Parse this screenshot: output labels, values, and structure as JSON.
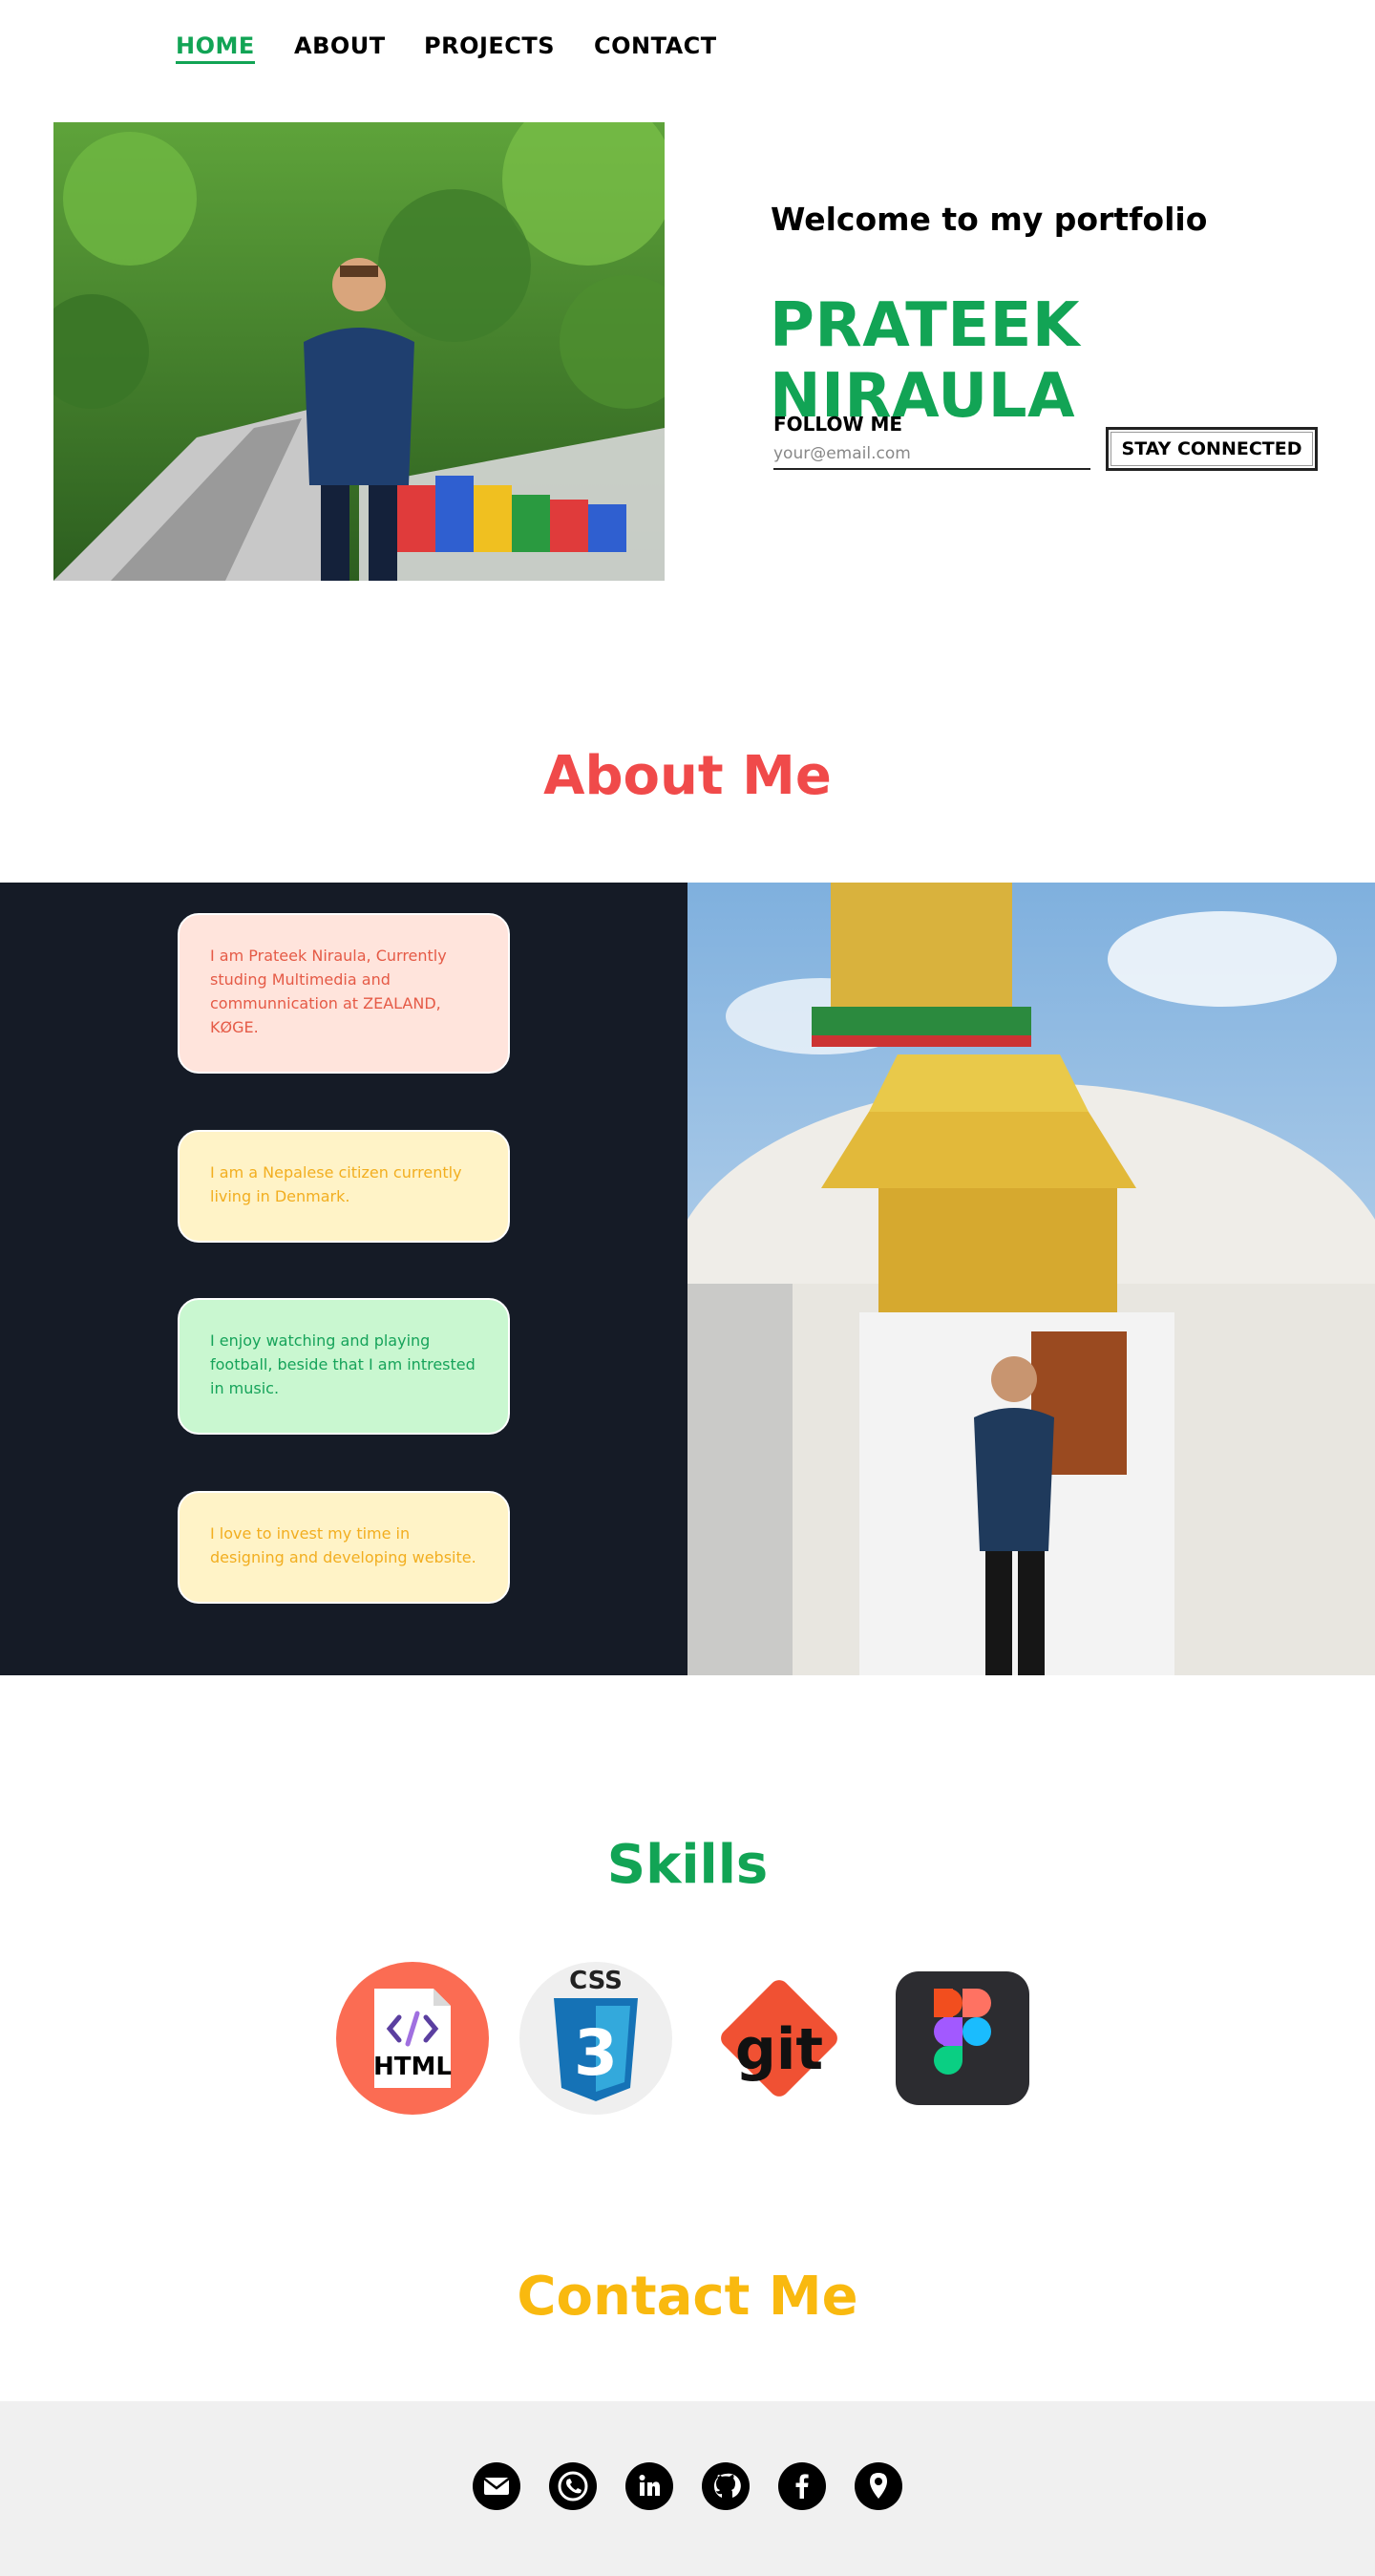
{
  "nav": {
    "items": [
      {
        "label": "HOME"
      },
      {
        "label": "ABOUT"
      },
      {
        "label": "PROJECTS"
      },
      {
        "label": "CONTACT"
      }
    ],
    "active_color": "#12a455"
  },
  "hero": {
    "welcome": "Welcome to my portfolio",
    "name": "PRATEEK NIRAULA",
    "follow_label": "FOLLOW ME",
    "email_placeholder": "your@email.com",
    "button_label": "STAY CONNECTED"
  },
  "about": {
    "heading": "About Me",
    "cards": [
      {
        "text": "I am Prateek Niraula, Currently studing Multimedia and communnication at ZEALAND, KØGE."
      },
      {
        "text": "I am a Nepalese citizen currently living in Denmark."
      },
      {
        "text": "I enjoy watching and playing football, beside that I am intrested in music."
      },
      {
        "text": "I love to invest my time in designing and developing website."
      }
    ]
  },
  "skills": {
    "heading": "Skills",
    "items": [
      {
        "name": "html-icon",
        "label": "HTML"
      },
      {
        "name": "css-icon",
        "label": "CSS"
      },
      {
        "name": "git-icon",
        "label": "git"
      },
      {
        "name": "figma-icon"
      }
    ]
  },
  "contact": {
    "heading": "Contact Me",
    "socials": [
      "email-icon",
      "phone-icon",
      "linkedin-icon",
      "github-icon",
      "facebook-icon",
      "location-icon"
    ]
  },
  "colors": {
    "green": "#12a455",
    "red": "#f04a4a",
    "yellow": "#f9b90f",
    "dark_panel": "#151b26"
  }
}
